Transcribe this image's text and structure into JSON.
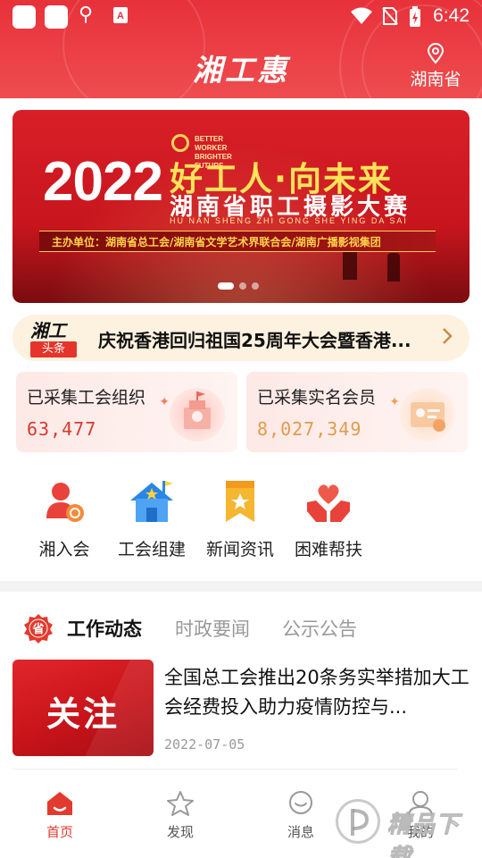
{
  "status_bar": {
    "time": "6:42",
    "icons": [
      "app-square-icon",
      "app-square-icon",
      "kite-app-icon",
      "text-app-icon",
      "wifi-icon",
      "no-sim-icon",
      "battery-charging-icon"
    ]
  },
  "header": {
    "title": "湘工惠",
    "location": "湖南省",
    "location_icon": "location-pin-icon",
    "color": "#e8313a"
  },
  "banner": {
    "slogan_line1": "BETTER WORKER",
    "slogan_line2": "BRIGHTER FUTURE",
    "year": "2022",
    "theme": "好工人·向未来",
    "subtitle": "湖南省职工摄影大赛",
    "pinyin": "HU NAN SHENG ZHI GONG SHE YING DA SAI",
    "host": "主办单位：湖南省总工会/湖南省文学艺术界联合会/湖南广播影视集团",
    "active_dot": 0,
    "dot_count": 3
  },
  "ticker": {
    "badge_top": "湘工",
    "badge_bottom": "头条",
    "text": "庆祝香港回归祖国25周年大会暨香港..."
  },
  "stats": [
    {
      "label": "已采集工会组织",
      "value": "63,477"
    },
    {
      "label": "已采集实名会员",
      "value": "8,027,349"
    }
  ],
  "entries": [
    {
      "label": "湘入会",
      "icon": "member-join-icon"
    },
    {
      "label": "工会组建",
      "icon": "house-star-icon"
    },
    {
      "label": "新闻资讯",
      "icon": "news-ribbon-icon"
    },
    {
      "label": "困难帮扶",
      "icon": "hands-heart-icon"
    }
  ],
  "news_tabs": {
    "badge": "省",
    "tabs": [
      "工作动态",
      "时政要闻",
      "公示公告"
    ],
    "active": 0
  },
  "article": {
    "thumb_text": "关注",
    "title": "全国总工会推出20条务实举措加大工会经费投入助力疫情防控与...",
    "date": "2022-07-05"
  },
  "bottom_nav": [
    {
      "label": "首页",
      "icon": "home-icon",
      "active": true
    },
    {
      "label": "发现",
      "icon": "star-icon",
      "active": false
    },
    {
      "label": "消息",
      "icon": "message-icon",
      "active": false
    },
    {
      "label": "我的",
      "icon": "profile-icon",
      "active": false
    }
  ],
  "watermark": {
    "text": "精品下载"
  },
  "colors": {
    "accent": "#e23a2e",
    "stat_orange": "#e49a4a",
    "ticker_bg": "#fdf2df"
  }
}
